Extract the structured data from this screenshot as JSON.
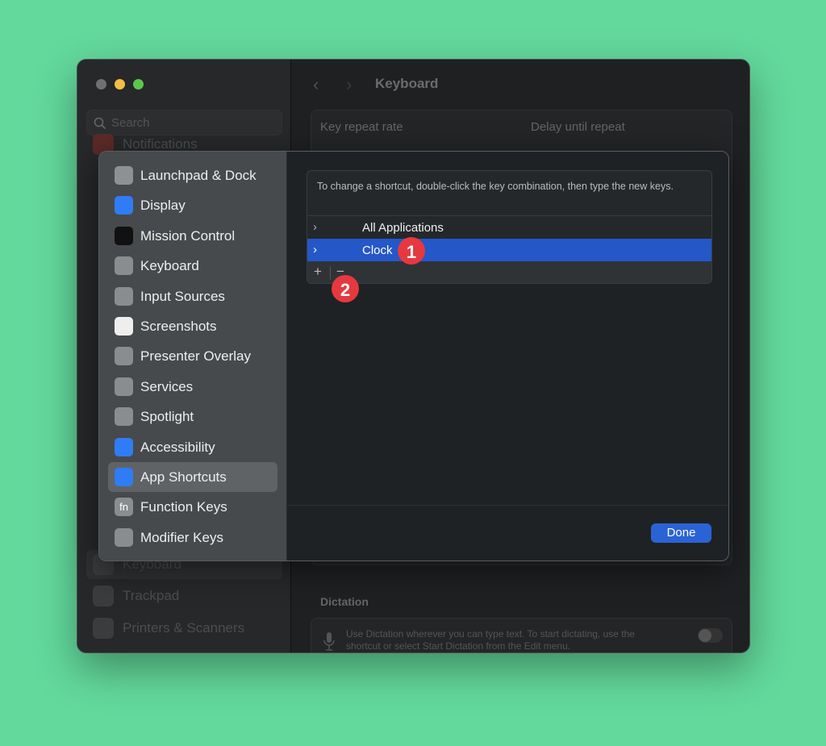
{
  "window": {
    "title": "Keyboard",
    "search_placeholder": "Search"
  },
  "background_sidebar": {
    "items": [
      {
        "label": "Notifications"
      },
      {
        "label": "Keyboard"
      },
      {
        "label": "Trackpad"
      },
      {
        "label": "Printers & Scanners"
      }
    ]
  },
  "background_main": {
    "key_repeat_rate": "Key repeat rate",
    "delay_until_repeat": "Delay until repeat",
    "dictation_heading": "Dictation",
    "dictation_text": "Use Dictation wherever you can type text. To start dictating, use the shortcut or select Start Dictation from the Edit menu.",
    "dictation_enabled": false
  },
  "sheet": {
    "sidebar": [
      {
        "label": "Launchpad & Dock",
        "icon": "launchpad-icon"
      },
      {
        "label": "Display",
        "icon": "display-icon"
      },
      {
        "label": "Mission Control",
        "icon": "mission-control-icon"
      },
      {
        "label": "Keyboard",
        "icon": "keyboard-icon"
      },
      {
        "label": "Input Sources",
        "icon": "keyboard-icon"
      },
      {
        "label": "Screenshots",
        "icon": "screenshot-icon"
      },
      {
        "label": "Presenter Overlay",
        "icon": "presenter-icon"
      },
      {
        "label": "Services",
        "icon": "gears-icon"
      },
      {
        "label": "Spotlight",
        "icon": "magnifier-icon"
      },
      {
        "label": "Accessibility",
        "icon": "accessibility-icon"
      },
      {
        "label": "App Shortcuts",
        "icon": "app-store-icon",
        "selected": true
      },
      {
        "label": "Function Keys",
        "icon": "fn-icon",
        "glyph": "fn"
      },
      {
        "label": "Modifier Keys",
        "icon": "shift-arrow-icon"
      }
    ],
    "hint": "To change a shortcut, double-click the key combination, then type the new keys.",
    "rows": [
      {
        "label": "All Applications"
      },
      {
        "label": "Clock",
        "selected": true
      }
    ],
    "add": "+",
    "remove": "−",
    "done": "Done",
    "annotations": [
      "1",
      "2"
    ]
  },
  "colors": {
    "accent": "#2457c8",
    "done": "#2a63d6",
    "badge": "#e5393f",
    "background": "#63d99c"
  }
}
